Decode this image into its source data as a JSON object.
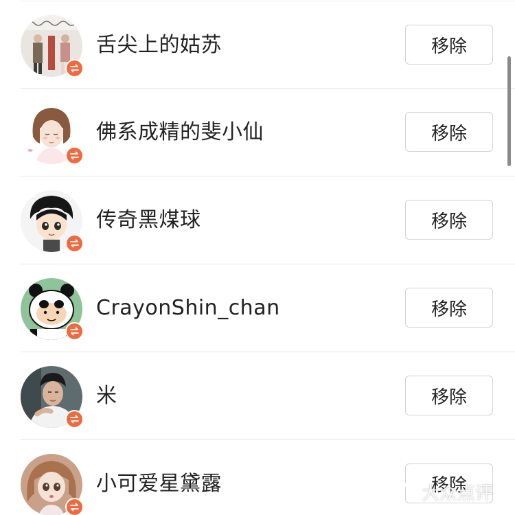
{
  "colors": {
    "badge": "#ef6b3f",
    "divider": "#e6e6e6",
    "button_border": "#d2d2d2",
    "text": "#222222"
  },
  "rows": [
    {
      "name": "舌尖上的姑苏",
      "button": "移除",
      "avatar_icon": "avatar-couple-photo-icon"
    },
    {
      "name": "佛系成精的斐小仙",
      "button": "移除",
      "avatar_icon": "avatar-illustrated-girl-icon"
    },
    {
      "name": "传奇黑煤球",
      "button": "移除",
      "avatar_icon": "avatar-cartoon-boy-icon"
    },
    {
      "name": "CrayonShin_chan",
      "button": "移除",
      "avatar_icon": "avatar-panda-shinchan-icon"
    },
    {
      "name": "米",
      "button": "移除",
      "avatar_icon": "avatar-man-photo-icon"
    },
    {
      "name": "小可爱星黛露",
      "button": "移除",
      "avatar_icon": "avatar-doll-photo-icon"
    }
  ],
  "watermark": {
    "text": "大众点评"
  }
}
